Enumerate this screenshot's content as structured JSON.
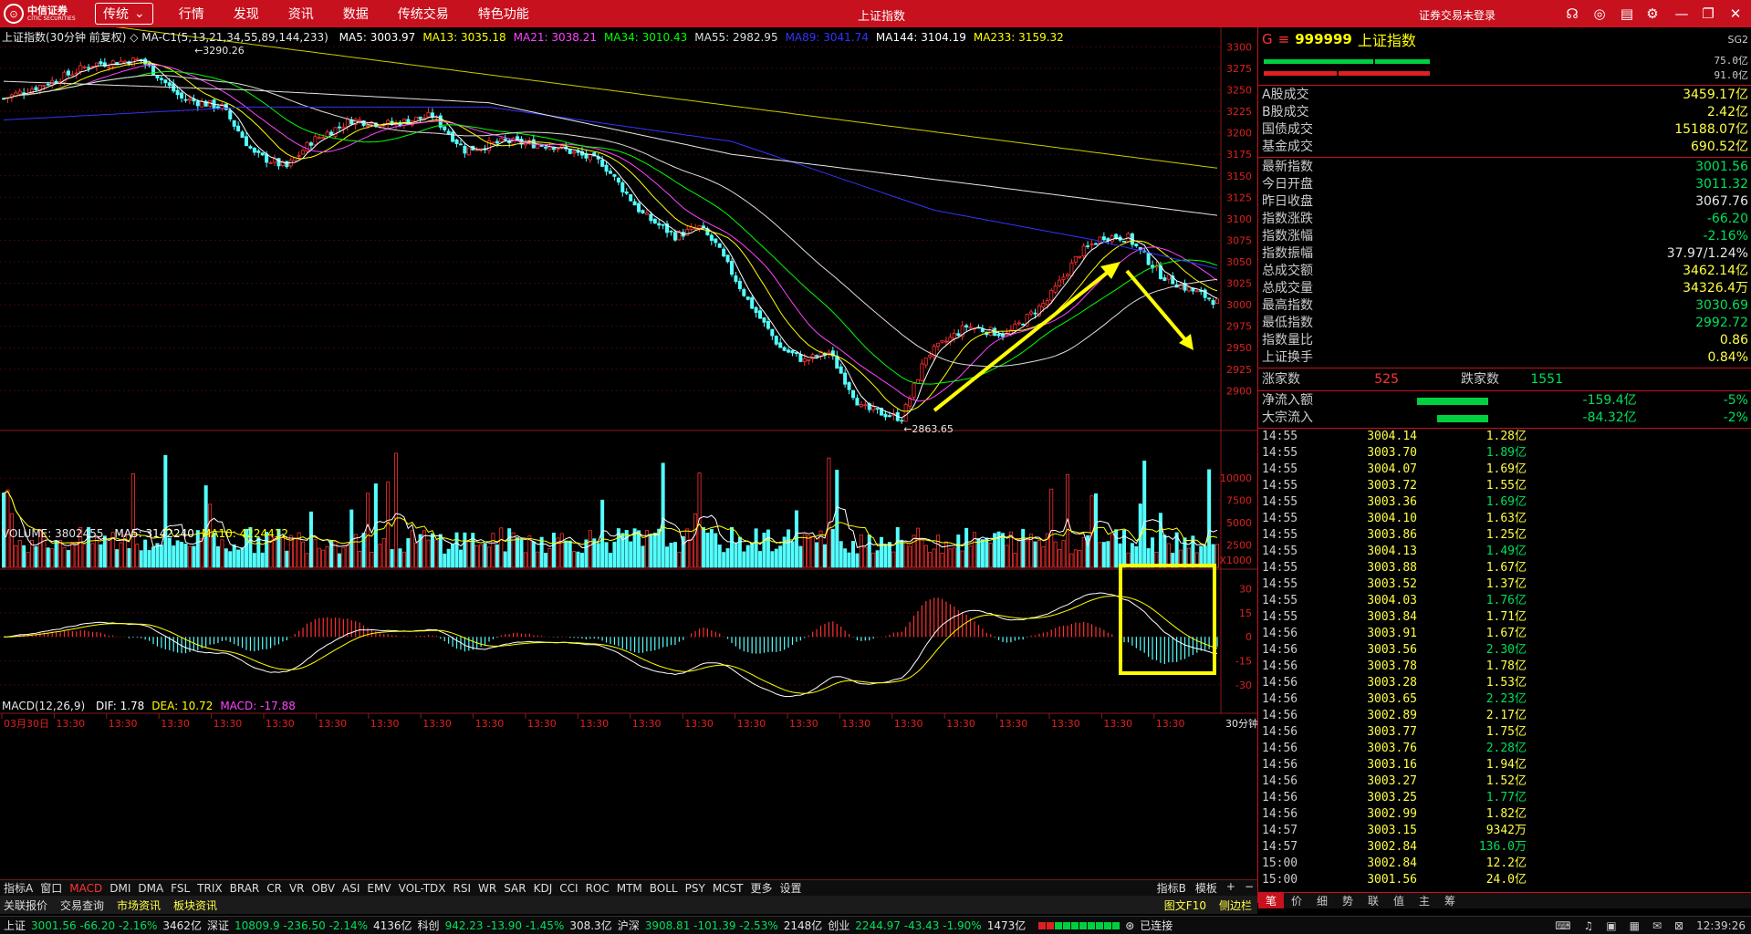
{
  "app": {
    "logo_cn": "中信证券",
    "logo_en": "CITIC SECURITIES",
    "mode": "传统",
    "mode_caret": "⌄",
    "menu": [
      "行情",
      "发现",
      "资讯",
      "数据",
      "传统交易",
      "特色功能"
    ],
    "title": "上证指数",
    "login": "证券交易未登录"
  },
  "pane": {
    "main_title": "上证指数(30分钟 前复权) ◇ MA-C1(5,13,21,34,55,89,144,233)",
    "ma": [
      {
        "t": "MA5: 3003.97",
        "c": "#ffffff"
      },
      {
        "t": "MA13: 3035.18",
        "c": "#ffff00"
      },
      {
        "t": "MA21: 3038.21",
        "c": "#ff44ff"
      },
      {
        "t": "MA34: 3010.43",
        "c": "#00ff00"
      },
      {
        "t": "MA55: 2982.95",
        "c": "#dddddd"
      },
      {
        "t": "MA89: 3041.74",
        "c": "#3333ff"
      },
      {
        "t": "MA144: 3104.19",
        "c": "#ffffff"
      },
      {
        "t": "MA233: 3159.32",
        "c": "#ffff00"
      }
    ],
    "vol_title": "VOLUME: 3802455",
    "vol_ma": [
      {
        "t": "MA5: 3142240",
        "c": "#ffffff"
      },
      {
        "t": "MA10: 4224412",
        "c": "#ffff00"
      }
    ],
    "macd_title": "MACD(12,26,9)",
    "macd_vals": [
      {
        "t": "DIF: 1.78",
        "c": "#ffffff"
      },
      {
        "t": "DEA: 10.72",
        "c": "#ffff00"
      },
      {
        "t": "MACD: -17.88",
        "c": "#ff44ff"
      }
    ],
    "hi_label": "3290.26",
    "lo_label": "2863.65",
    "x1000": "X1000",
    "period": "30分钟"
  },
  "chart_data": {
    "type": "candlestick",
    "symbol": "上证指数",
    "period": "30分钟",
    "price_ticks": [
      3300,
      3275,
      3250,
      3225,
      3200,
      3175,
      3150,
      3125,
      3100,
      3075,
      3050,
      3025,
      3000,
      2975,
      2950,
      2925,
      2900
    ],
    "price_ylim": [
      2860,
      3310
    ],
    "vol_ticks": [
      10000,
      7500,
      5000,
      2500
    ],
    "vol_ylim": [
      0,
      13500
    ],
    "macd_ticks": [
      30,
      15,
      0,
      -15,
      -30
    ],
    "macd_ylim": [
      -42,
      40
    ],
    "x_labels": [
      "03月30日",
      "13:30",
      "13:30",
      "13:30",
      "13:30",
      "13:30",
      "13:30",
      "13:30",
      "13:30",
      "13:30",
      "13:30",
      "13:30",
      "13:30",
      "13:30",
      "13:30",
      "13:30",
      "13:30",
      "13:30",
      "13:30",
      "13:30",
      "13:30",
      "13:30",
      "13:30"
    ],
    "high": 3290.26,
    "low": 2863.65,
    "anchors": [
      [
        0,
        3240
      ],
      [
        12,
        3260
      ],
      [
        22,
        3280
      ],
      [
        34,
        3285
      ],
      [
        44,
        3240
      ],
      [
        54,
        3230
      ],
      [
        62,
        3175
      ],
      [
        70,
        3160
      ],
      [
        76,
        3190
      ],
      [
        86,
        3215
      ],
      [
        96,
        3210
      ],
      [
        106,
        3220
      ],
      [
        114,
        3180
      ],
      [
        124,
        3190
      ],
      [
        136,
        3185
      ],
      [
        148,
        3165
      ],
      [
        158,
        3105
      ],
      [
        166,
        3080
      ],
      [
        172,
        3090
      ],
      [
        176,
        3070
      ],
      [
        184,
        3005
      ],
      [
        192,
        2950
      ],
      [
        198,
        2935
      ],
      [
        204,
        2945
      ],
      [
        212,
        2880
      ],
      [
        222,
        2868
      ],
      [
        228,
        2940
      ],
      [
        238,
        2975
      ],
      [
        248,
        2965
      ],
      [
        258,
        3005
      ],
      [
        266,
        3060
      ],
      [
        272,
        3080
      ],
      [
        278,
        3078
      ],
      [
        286,
        3035
      ],
      [
        292,
        3020
      ],
      [
        296,
        3012
      ],
      [
        300,
        3003
      ]
    ],
    "ma_colors": [
      "#ffffff",
      "#ffff00",
      "#ff44ff",
      "#00ff00",
      "#dddddd",
      "#3333ff",
      "#ffffff",
      "#ffff00"
    ],
    "ma_periods": [
      5,
      13,
      21,
      34,
      55,
      89,
      144,
      233
    ],
    "ma233_series": [
      [
        0,
        3340
      ],
      [
        300,
        3159
      ]
    ],
    "ma144_series": [
      [
        0,
        3260
      ],
      [
        60,
        3250
      ],
      [
        120,
        3235
      ],
      [
        180,
        3175
      ],
      [
        240,
        3140
      ],
      [
        300,
        3104
      ]
    ],
    "ma89_series": [
      [
        0,
        3215
      ],
      [
        60,
        3230
      ],
      [
        120,
        3230
      ],
      [
        180,
        3190
      ],
      [
        230,
        3110
      ],
      [
        270,
        3075
      ],
      [
        300,
        3042
      ]
    ]
  },
  "right": {
    "g": "G",
    "menu_icon": "≡",
    "code": "999999",
    "name": "上证指数",
    "sg": "SG2",
    "bar_vals": [
      "75.0亿",
      "91.0亿"
    ],
    "top": [
      {
        "k": "A股成交",
        "v": "3459.17亿",
        "c": "#ffff44"
      },
      {
        "k": "B股成交",
        "v": "2.42亿",
        "c": "#ffff44"
      },
      {
        "k": "国债成交",
        "v": "15188.07亿",
        "c": "#ffff44"
      },
      {
        "k": "基金成交",
        "v": "690.52亿",
        "c": "#ffff44"
      }
    ],
    "mid": [
      {
        "k": "最新指数",
        "v": "3001.56",
        "c": "#00e05a"
      },
      {
        "k": "今日开盘",
        "v": "3011.32",
        "c": "#00e05a"
      },
      {
        "k": "昨日收盘",
        "v": "3067.76",
        "c": "#e6e6e6"
      },
      {
        "k": "指数涨跌",
        "v": "-66.20",
        "c": "#00e05a"
      },
      {
        "k": "指数涨幅",
        "v": "-2.16%",
        "c": "#00e05a"
      },
      {
        "k": "指数振幅",
        "v": "37.97/1.24%",
        "c": "#e6e6e6"
      },
      {
        "k": "总成交额",
        "v": "3462.14亿",
        "c": "#ffff44"
      },
      {
        "k": "总成交量",
        "v": "34326.4万",
        "c": "#ffff44"
      },
      {
        "k": "最高指数",
        "v": "3030.69",
        "c": "#00e05a"
      },
      {
        "k": "最低指数",
        "v": "2992.72",
        "c": "#00e05a"
      },
      {
        "k": "指数量比",
        "v": "0.86",
        "c": "#ffff44"
      },
      {
        "k": "上证换手",
        "v": "0.84%",
        "c": "#ffff44"
      }
    ],
    "up_label": "涨家数",
    "up_val": "525",
    "down_label": "跌家数",
    "down_val": "1551",
    "flows": [
      {
        "k": "净流入额",
        "v": "-159.4亿",
        "p": "-5%",
        "w": 78
      },
      {
        "k": "大宗流入",
        "v": "-84.32亿",
        "p": "-2%",
        "w": 56
      }
    ],
    "ticks": [
      [
        "14:55",
        "3004.14",
        "1.28亿"
      ],
      [
        "14:55",
        "3003.70",
        "1.89亿"
      ],
      [
        "14:55",
        "3004.07",
        "1.69亿"
      ],
      [
        "14:55",
        "3003.72",
        "1.55亿"
      ],
      [
        "14:55",
        "3003.36",
        "1.69亿"
      ],
      [
        "14:55",
        "3004.10",
        "1.63亿"
      ],
      [
        "14:55",
        "3003.86",
        "1.25亿"
      ],
      [
        "14:55",
        "3004.13",
        "1.49亿"
      ],
      [
        "14:55",
        "3003.88",
        "1.67亿"
      ],
      [
        "14:55",
        "3003.52",
        "1.37亿"
      ],
      [
        "14:55",
        "3004.03",
        "1.76亿"
      ],
      [
        "14:55",
        "3003.84",
        "1.71亿"
      ],
      [
        "14:56",
        "3003.91",
        "1.67亿"
      ],
      [
        "14:56",
        "3003.56",
        "2.30亿"
      ],
      [
        "14:56",
        "3003.78",
        "1.78亿"
      ],
      [
        "14:56",
        "3003.28",
        "1.53亿"
      ],
      [
        "14:56",
        "3003.65",
        "2.23亿"
      ],
      [
        "14:56",
        "3002.89",
        "2.17亿"
      ],
      [
        "14:56",
        "3003.77",
        "1.75亿"
      ],
      [
        "14:56",
        "3003.76",
        "2.28亿"
      ],
      [
        "14:56",
        "3003.16",
        "1.94亿"
      ],
      [
        "14:56",
        "3003.27",
        "1.52亿"
      ],
      [
        "14:56",
        "3003.25",
        "1.77亿"
      ],
      [
        "14:56",
        "3002.99",
        "1.82亿"
      ],
      [
        "14:57",
        "3003.15",
        "9342万"
      ],
      [
        "14:57",
        "3002.84",
        "136.0万"
      ],
      [
        "15:00",
        "3002.84",
        "12.2亿"
      ],
      [
        "15:00",
        "3001.56",
        "24.0亿"
      ]
    ],
    "tabs": [
      "笔",
      "价",
      "细",
      "势",
      "联",
      "值",
      "主",
      "筹"
    ]
  },
  "indicators": [
    "指标A",
    "窗口",
    "MACD",
    "DMI",
    "DMA",
    "FSL",
    "TRIX",
    "BRAR",
    "CR",
    "VR",
    "OBV",
    "ASI",
    "EMV",
    "VOL-TDX",
    "RSI",
    "WR",
    "SAR",
    "KDJ",
    "CCI",
    "ROC",
    "MTM",
    "BOLL",
    "PSY",
    "MCST",
    "更多",
    "设置"
  ],
  "ind_right": [
    "指标B",
    "模板",
    "+",
    "−"
  ],
  "sub": [
    "关联报价",
    "交易查询",
    "市场资讯",
    "板块资讯"
  ],
  "sub_right": [
    "图文F10",
    "侧边栏"
  ],
  "status": {
    "sh_label": "上证",
    "sh_vals": "3001.56  -66.20  -2.16%",
    "sh_amt": "3462亿",
    "sz_label": "深证",
    "sz_vals": "10809.9  -236.50  -2.14%",
    "sz_amt": "4136亿",
    "kc_label": "科创",
    "kc_vals": "942.23  -13.90  -1.45%",
    "kc_amt": "308.3亿",
    "hs_label": "沪深",
    "hs_vals": "3908.81  -101.39  -2.53%",
    "hs_amt": "2148亿",
    "cy_label": "创业",
    "cy_vals": "2244.97  -43.43  -1.90%",
    "cy_amt": "1473亿",
    "conn": "已连接",
    "time": "12:39:26"
  }
}
